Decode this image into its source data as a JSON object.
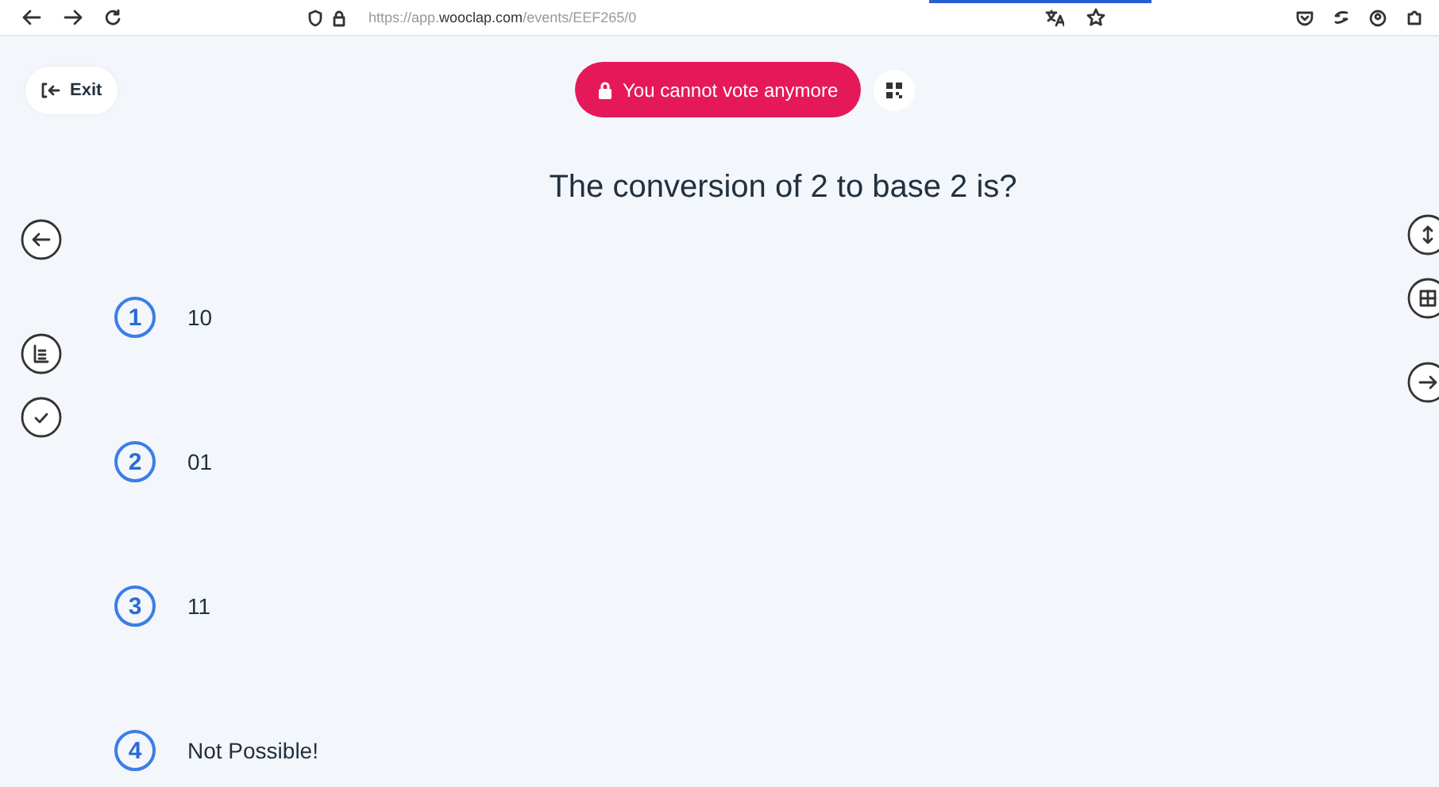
{
  "browser": {
    "url": "https://app.**wooclap.com**/events/EEF265/0"
  },
  "header": {
    "exit_label": "Exit",
    "status": "You cannot vote anymore"
  },
  "question": "The conversion of 2 to base 2 is?",
  "options": [
    {
      "number": "1",
      "text": "10"
    },
    {
      "number": "2",
      "text": "01"
    },
    {
      "number": "3",
      "text": "11"
    },
    {
      "number": "4",
      "text": "Not Possible!"
    }
  ]
}
